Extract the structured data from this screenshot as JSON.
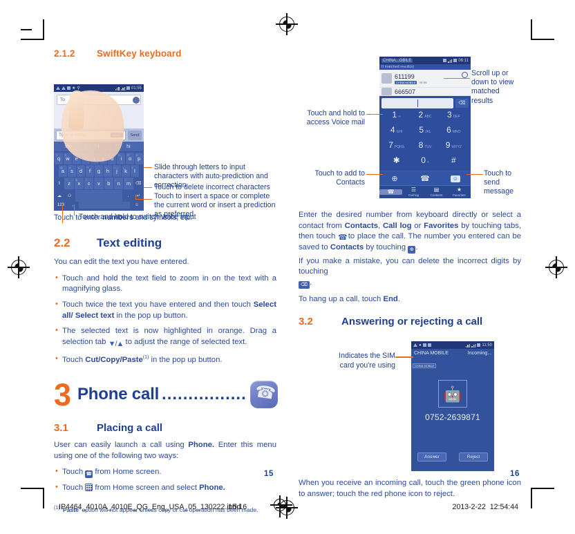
{
  "document": {
    "left_page_number": "15",
    "right_page_number": "16"
  },
  "print_strip": {
    "filename": "IP4464_4010A_4010E_QG_Eng_USA_05_130222.indd",
    "page_marker": "15-16",
    "date": "2013-2-22",
    "time": "12:54:44"
  },
  "left_column": {
    "section_212": {
      "number": "2.1.2",
      "title": "SwiftKey keyboard"
    },
    "keyboard_mock": {
      "status_time": "01:55",
      "to_label": "To",
      "compose_placeholder": "Type to comp.",
      "smart_badge": "SMART",
      "send_label": "Send",
      "predictions": [
        "the",
        "I",
        "hi"
      ],
      "row1": [
        "q",
        "w",
        "e",
        "r",
        "t",
        "y",
        "u",
        "i",
        "o",
        "p"
      ],
      "row1_sup": [
        "1",
        "2",
        "3",
        "4",
        "5",
        "6",
        "7",
        "8",
        "9",
        "0"
      ],
      "row2": [
        "a",
        "s",
        "d",
        "f",
        "g",
        "h",
        "j",
        "k",
        "l"
      ],
      "row2_sup": [
        "@",
        "#",
        "&",
        "*",
        "-",
        "+",
        "=",
        "(",
        ")"
      ],
      "row3": [
        "z",
        "x",
        "c",
        "v",
        "b",
        "n",
        "m"
      ],
      "row3_sup": [
        "~",
        "$",
        "^",
        ":",
        ";",
        "!",
        "/"
      ],
      "shift_key": "⇧",
      "delete_key": "⌫",
      "numbers_key": "123",
      "mic_key": "Ἲ4",
      "enter_key": "↵",
      "emoji_key": "☺"
    },
    "annotations": [
      "Slide through letters to input characters with auto-prediction and correction",
      "Touch to delete incorrect characters",
      "Touch to insert a space or complete the current word or insert a prediction as preferred",
      "Touch and hold to switch voice input",
      "Touch to enter numbers and symbols, etc."
    ],
    "annotation_numbers_bold": "numbers",
    "section_22": {
      "number": "2.2",
      "title": "Text editing",
      "intro": "You can edit the text you have entered.",
      "bullets": [
        {
          "pre": "Touch and hold the text field to zoom in on the text with a magnifying glass.",
          "bold": "",
          "post": ""
        },
        {
          "pre": "Touch twice the text you have entered and then touch ",
          "bold": "Select all/ Select text",
          "post": " in the pop up button."
        },
        {
          "pre": "The selected text is now highlighted in orange. Drag a selection tab ",
          "bold": "",
          "post": " to adjust the range of selected text."
        },
        {
          "pre": "Touch ",
          "bold": "Cut/Copy/Paste",
          "post": " in the pop up button."
        }
      ]
    },
    "chapter_3": {
      "number": "3",
      "title": "Phone call",
      "dots": "................",
      "icon": "phone-handset-icon"
    },
    "section_31": {
      "number": "3.1",
      "title": "Placing a call",
      "intro_pre": "User can easily launch a call using ",
      "intro_bold": "Phone.",
      "intro_post": " Enter this menu using one of the following two ways:",
      "bullet1_pre": "Touch ",
      "bullet1_post": " from Home screen.",
      "bullet2_pre": "Touch ",
      "bullet2_post": " from Home screen and select ",
      "bullet2_bold": "Phone."
    },
    "footnote": {
      "mark": "(1)",
      "bold": "'Paste'",
      "text": " option will not appear unless copy or cut operation has been made."
    }
  },
  "right_column": {
    "dialer_mock": {
      "carrier": "CHINA...OBILE",
      "status_time": "06:11",
      "matched_results": "0 matched result(s)",
      "results": [
        {
          "number": "611199",
          "sim": "CHINA MOBILE",
          "time": "06:06"
        },
        {
          "number": "666507",
          "sim": "",
          "time": ""
        }
      ],
      "delete_key": "⌫",
      "keys": [
        {
          "digit": "1",
          "sub": "∞"
        },
        {
          "digit": "2",
          "sub": "ABC"
        },
        {
          "digit": "3",
          "sub": "DEF"
        },
        {
          "digit": "4",
          "sub": "GHI"
        },
        {
          "digit": "5",
          "sub": "JKL"
        },
        {
          "digit": "6",
          "sub": "MNO"
        },
        {
          "digit": "7",
          "sub": "PQRS"
        },
        {
          "digit": "8",
          "sub": "TUV"
        },
        {
          "digit": "9",
          "sub": "WXYZ"
        },
        {
          "digit": "✱",
          "sub": ""
        },
        {
          "digit": "0",
          "sub": "+"
        },
        {
          "digit": "#",
          "sub": ""
        }
      ],
      "actions": [
        "add-contact-icon",
        "call-icon",
        "message-icon"
      ],
      "tabs": [
        {
          "label": "",
          "icon": "dialpad-icon"
        },
        {
          "label": "Call log",
          "icon": "list-icon"
        },
        {
          "label": "Contacts",
          "icon": "contacts-icon"
        },
        {
          "label": "Favorites",
          "icon": "star-icon"
        }
      ]
    },
    "annotations": {
      "scroll": "Scroll up or down to view matched results",
      "voicemail": "Touch and hold to access Voice mail",
      "add_contacts": "Touch to add to Contacts",
      "send_message": "Touch to send message",
      "sim": "Indicates the SIM card you're using"
    },
    "paragraph_1": {
      "p1": "Enter the desired number from keyboard directly or select a contact from ",
      "b1": "Contacts",
      "p2": ", ",
      "b2": "Call log",
      "p3": " or ",
      "b3": "Favorites",
      "p4": " by touching tabs, then touch ",
      "p5": " to place the call. The number you entered can be saved to ",
      "b4": "Contacts",
      "p6": " by touching ",
      "p7": ".",
      "p8": "If you make a mistake, you can delete the incorrect digits by touching ",
      "p9": "."
    },
    "paragraph_2": {
      "pre": "To hang up a call, touch ",
      "bold": "End",
      "post": "."
    },
    "section_32": {
      "number": "3.2",
      "title": "Answering or rejecting a call"
    },
    "incoming_mock": {
      "carrier": "CHINA MOBILE",
      "state": "Incoming...",
      "status_time": "11:50",
      "sim_chip": "CHINA MOBILE",
      "number": "0752-2639871",
      "answer_label": "Answer",
      "reject_label": "Reject"
    },
    "paragraph_3": "When you receive an incoming call, touch the green phone icon to answer; touch the red phone icon to reject."
  },
  "colors": {
    "heading_orange": "#ee6a1e",
    "heading_blue": "#1e3f92",
    "body_blue": "#2b4a9e",
    "phone_blue": "#2e4d9c"
  }
}
